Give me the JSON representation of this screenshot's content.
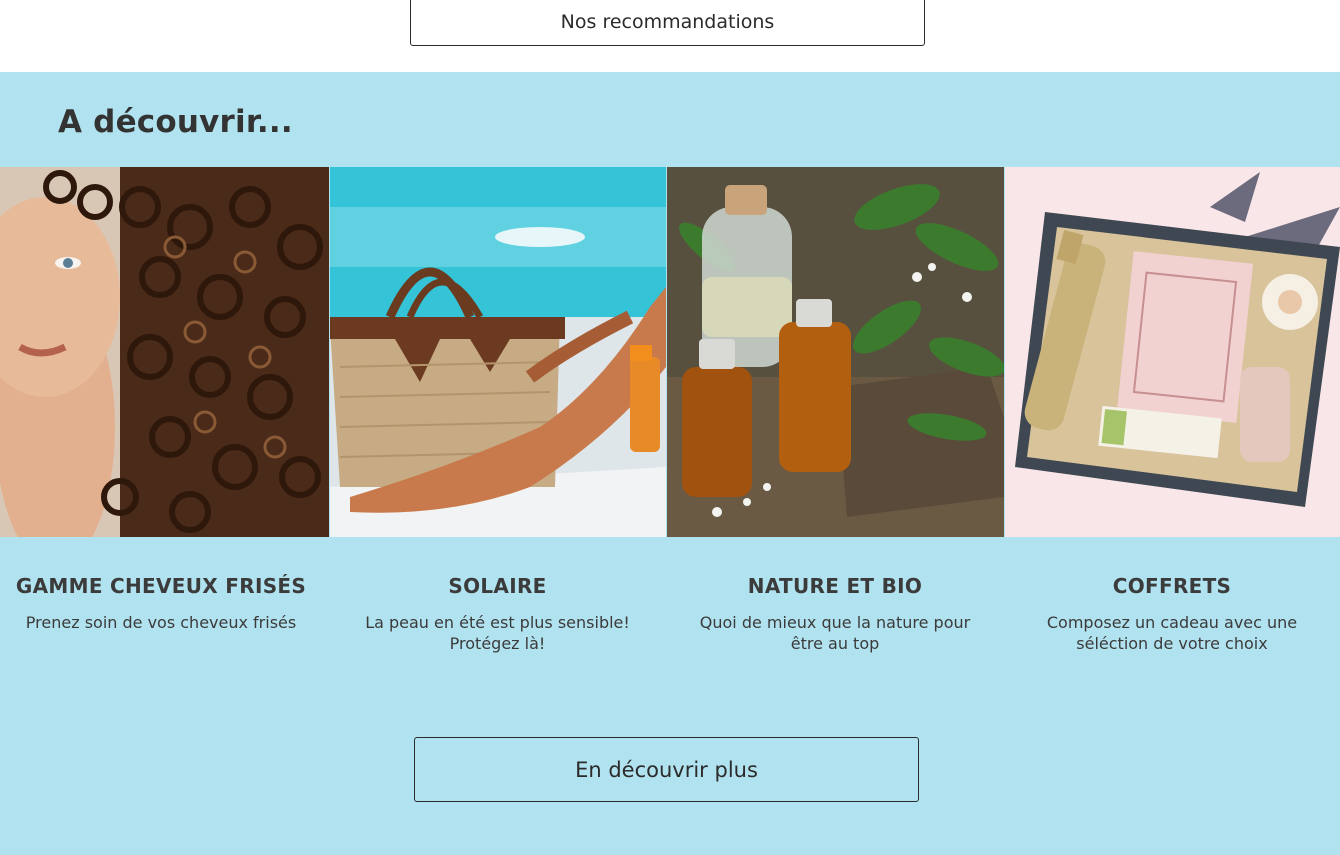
{
  "top": {
    "recommendations_label": "Nos recommandations"
  },
  "colors": {
    "section_background": "#b1e2ef",
    "text": "#333333",
    "button_border": "#2b2b2b"
  },
  "discover": {
    "title": "A découvrir...",
    "cards": [
      {
        "title": "GAMME CHEVEUX FRISÉS",
        "description": "Prenez soin de vos cheveux frisés",
        "image": "curly-hair-woman-photo"
      },
      {
        "title": "SOLAIRE",
        "description": "La peau en été est plus sensible! Protégez là!",
        "image": "beach-bag-sunscreen-photo"
      },
      {
        "title": "NATURE ET BIO",
        "description": "Quoi de mieux que la nature pour être au top",
        "image": "essential-oils-herbs-photo"
      },
      {
        "title": "COFFRETS",
        "description": "Composez un cadeau avec une séléction de votre choix",
        "image": "gift-box-photo"
      }
    ],
    "more_label": "En découvrir plus"
  }
}
